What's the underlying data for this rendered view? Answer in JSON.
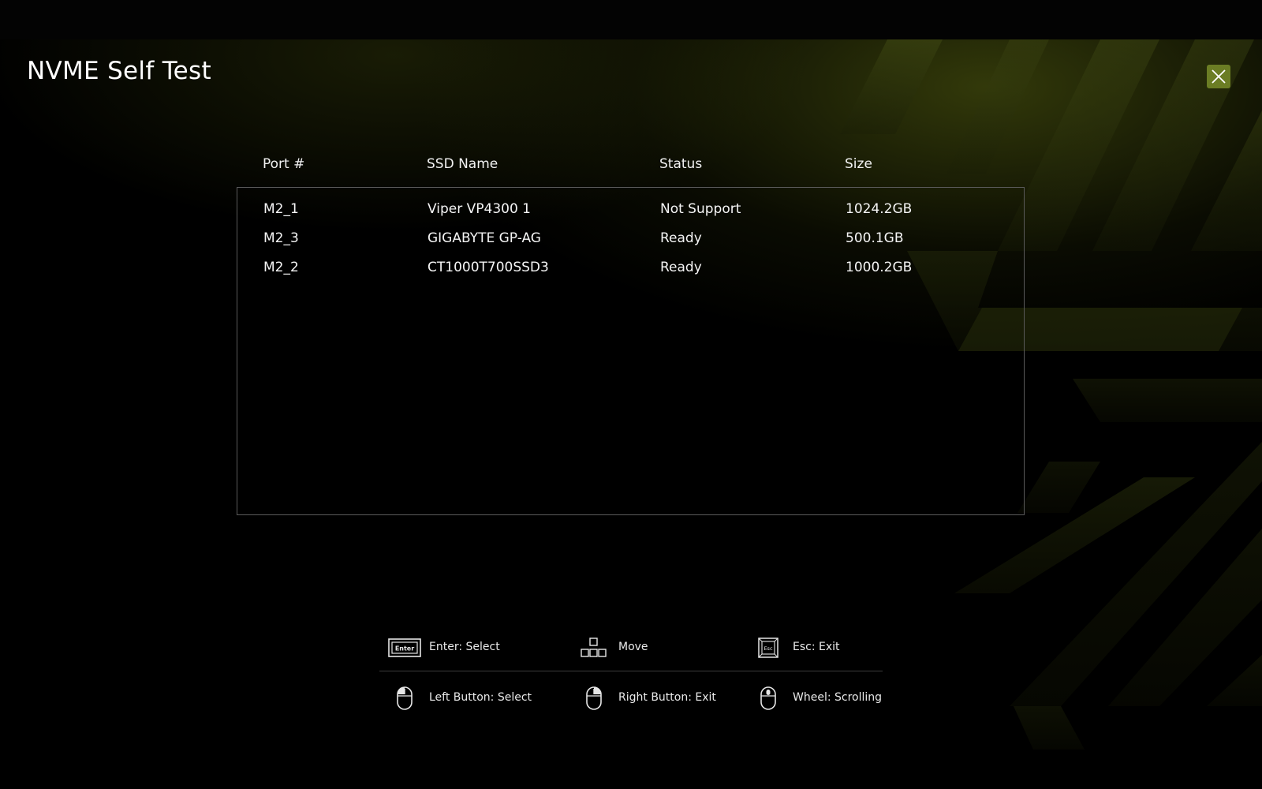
{
  "window": {
    "title": "NVME Self Test",
    "accent_color": "#6b7d24"
  },
  "icons": {
    "close": "close-icon"
  },
  "table": {
    "columns": [
      "Port #",
      "SSD Name",
      "Status",
      "Size"
    ],
    "rows": [
      {
        "port": "M2_1",
        "name": "Viper VP4300 1",
        "status": "Not Support",
        "size": "1024.2GB"
      },
      {
        "port": "M2_3",
        "name": "GIGABYTE GP-AG",
        "status": "Ready",
        "size": "500.1GB"
      },
      {
        "port": "M2_2",
        "name": "CT1000T700SSD3",
        "status": "Ready",
        "size": "1000.2GB"
      }
    ]
  },
  "hints": {
    "enter": {
      "label": "Enter: Select",
      "icon": "enter-key-icon",
      "key_text": "Enter"
    },
    "move": {
      "label": "Move",
      "icon": "arrow-keys-icon"
    },
    "esc": {
      "label": "Esc: Exit",
      "icon": "esc-key-icon",
      "key_text": "Esc"
    },
    "left_button": {
      "label": "Left Button: Select",
      "icon": "mouse-left-icon"
    },
    "right_button": {
      "label": "Right Button: Exit",
      "icon": "mouse-right-icon"
    },
    "wheel": {
      "label": "Wheel: Scrolling",
      "icon": "mouse-wheel-icon"
    }
  }
}
